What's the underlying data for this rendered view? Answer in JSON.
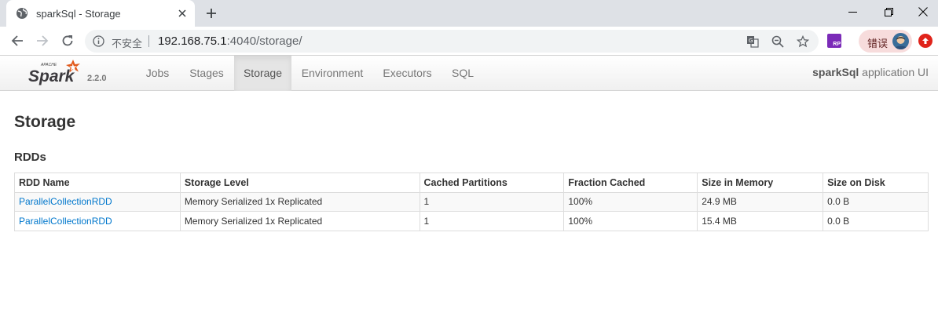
{
  "browser": {
    "tab_title": "sparkSql - Storage",
    "url_host": "192.168.75.1",
    "url_rest": ":4040/storage/",
    "security_label": "不安全",
    "profile_label": "错误",
    "extension_label": "RP",
    "icons": [
      "globe-icon",
      "close-icon",
      "plus-icon",
      "minimize-icon",
      "maximize-icon",
      "close-window-icon",
      "back-icon",
      "forward-icon",
      "reload-icon",
      "info-icon",
      "translate-icon",
      "zoom-out-icon",
      "star-icon",
      "avatar-icon",
      "update-icon"
    ]
  },
  "spark": {
    "logo_top": "APACHE",
    "logo_word": "Spark",
    "version": "2.2.0",
    "tabs": [
      {
        "label": "Jobs"
      },
      {
        "label": "Stages"
      },
      {
        "label": "Storage",
        "active": true
      },
      {
        "label": "Environment"
      },
      {
        "label": "Executors"
      },
      {
        "label": "SQL"
      }
    ],
    "app_name": "sparkSql",
    "app_suffix": " application UI",
    "brand_color": "#e25a1c"
  },
  "page": {
    "title": "Storage",
    "section": "RDDs",
    "table": {
      "headers": [
        "RDD Name",
        "Storage Level",
        "Cached Partitions",
        "Fraction Cached",
        "Size in Memory",
        "Size on Disk"
      ],
      "rows": [
        [
          "ParallelCollectionRDD",
          "Memory Serialized 1x Replicated",
          "1",
          "100%",
          "24.9 MB",
          "0.0 B"
        ],
        [
          "ParallelCollectionRDD",
          "Memory Serialized 1x Replicated",
          "1",
          "100%",
          "15.4 MB",
          "0.0 B"
        ]
      ]
    }
  }
}
